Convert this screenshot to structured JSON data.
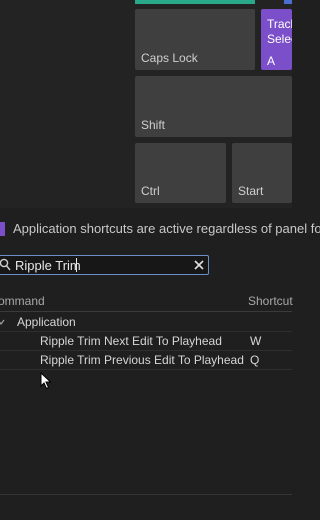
{
  "keyboard": {
    "keys": {
      "caps_lock": "Caps Lock",
      "shift": "Shift",
      "ctrl": "Ctrl",
      "start": "Start",
      "a_key_command": "Track\nSelect",
      "a_key_letter": "A"
    },
    "colors": {
      "app_shortcut": "#7a4fc9",
      "panel_shortcut": "#2aa88a"
    }
  },
  "legend": {
    "text": "Application shortcuts are active regardless of panel focu"
  },
  "search": {
    "value": "Ripple Trim",
    "icon": "search-icon",
    "clear_icon": "close-icon"
  },
  "table": {
    "headers": {
      "command": "ommand",
      "shortcut": "Shortcut"
    },
    "group": "Application",
    "rows": [
      {
        "command": "Ripple Trim Next Edit To Playhead",
        "shortcut": "W"
      },
      {
        "command": "Ripple Trim Previous Edit To Playhead",
        "shortcut": "Q"
      }
    ]
  }
}
